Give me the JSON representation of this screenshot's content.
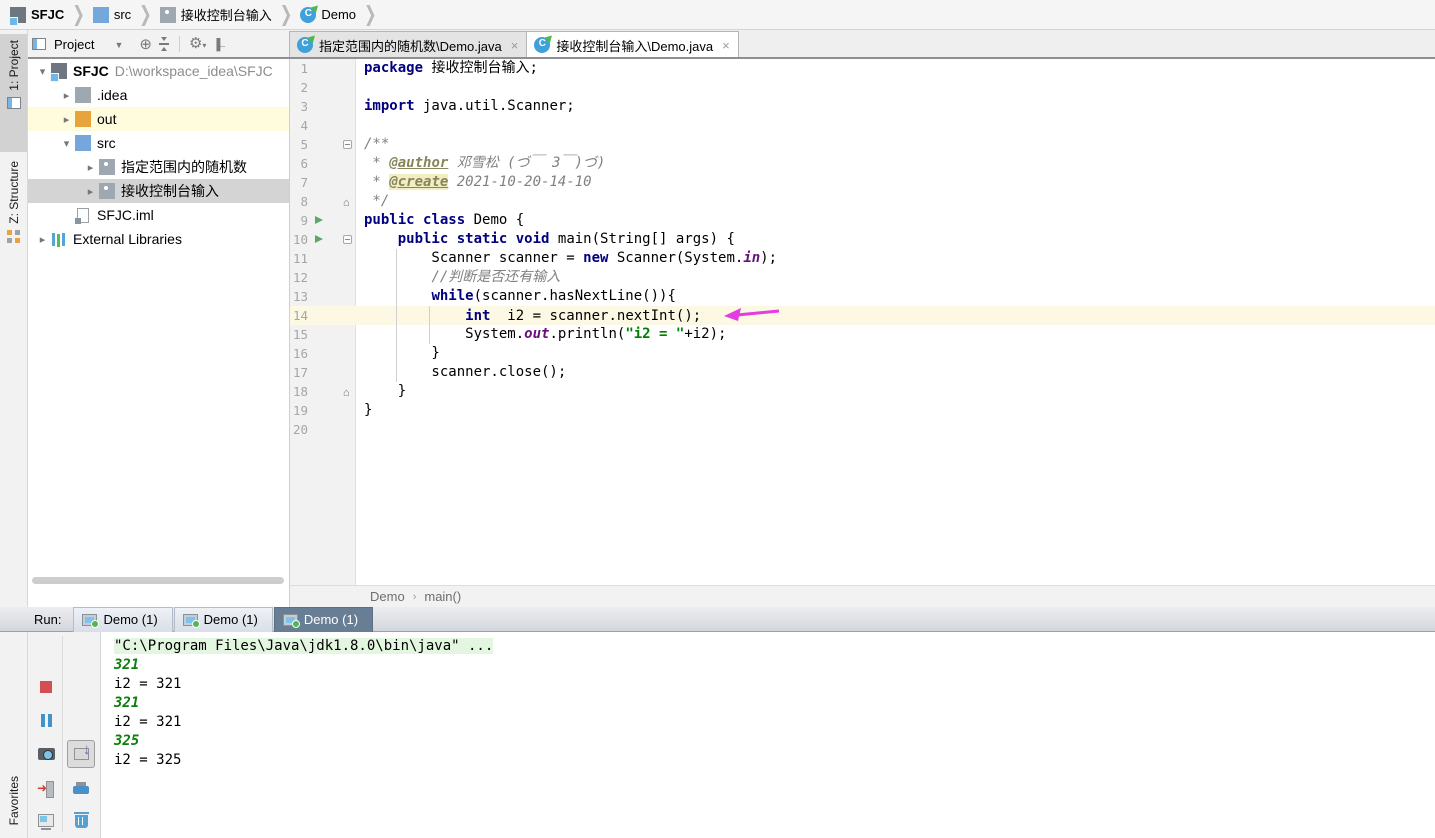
{
  "topbar": {
    "items": [
      {
        "icon": "project-root",
        "label": "SFJC",
        "bold": true
      },
      {
        "icon": "folder-blue",
        "label": "src"
      },
      {
        "icon": "package",
        "label": "接收控制台输入"
      },
      {
        "icon": "class",
        "label": "Demo"
      }
    ]
  },
  "left_tools": {
    "project": "1: Project",
    "structure": "Z: Structure",
    "favorites": "Favorites"
  },
  "project_panel": {
    "title": "Project"
  },
  "editor_tabs": [
    {
      "icon": "class",
      "label": "指定范围内的随机数\\Demo.java",
      "selected": false
    },
    {
      "icon": "class",
      "label": "接收控制台输入\\Demo.java",
      "selected": true
    }
  ],
  "tree": [
    {
      "indent": 0,
      "chevron": "down",
      "icon": "project-root",
      "label": "SFJC",
      "suffix": " D:\\workspace_idea\\SFJC",
      "bold": true
    },
    {
      "indent": 1,
      "chevron": "right",
      "icon": "folder-gray",
      "label": ".idea"
    },
    {
      "indent": 1,
      "chevron": "right",
      "icon": "folder-orange",
      "label": "out",
      "state": "marked"
    },
    {
      "indent": 1,
      "chevron": "down",
      "icon": "folder-blue",
      "label": "src"
    },
    {
      "indent": 2,
      "chevron": "right",
      "icon": "package",
      "label": "指定范围内的随机数"
    },
    {
      "indent": 2,
      "chevron": "right",
      "icon": "package",
      "label": "接收控制台输入",
      "state": "selected"
    },
    {
      "indent": 1,
      "chevron": "none",
      "icon": "file-iml",
      "label": "SFJC.iml"
    },
    {
      "indent": 0,
      "chevron": "right",
      "icon": "library",
      "label": "External Libraries"
    }
  ],
  "code": {
    "lines": [
      {
        "n": 1,
        "segs": [
          [
            "kw",
            "package"
          ],
          [
            "pl",
            " 接收控制台输入;"
          ]
        ]
      },
      {
        "n": 2,
        "segs": []
      },
      {
        "n": 3,
        "segs": [
          [
            "kw",
            "import"
          ],
          [
            "pl",
            " java.util.Scanner;"
          ]
        ]
      },
      {
        "n": 4,
        "segs": []
      },
      {
        "n": 5,
        "fold": "minus",
        "segs": [
          [
            "doc",
            "/**"
          ]
        ]
      },
      {
        "n": 6,
        "segs": [
          [
            "doc",
            " * "
          ],
          [
            "tag",
            "@author"
          ],
          [
            "doc",
            " 邓雪松 (づ￣ 3￣)づ)"
          ]
        ]
      },
      {
        "n": 7,
        "segs": [
          [
            "doc",
            " * "
          ],
          [
            "taghl",
            "@create"
          ],
          [
            "doc",
            " 2021-10-20-14-10"
          ]
        ]
      },
      {
        "n": 8,
        "fold": "end",
        "segs": [
          [
            "doc",
            " */"
          ]
        ]
      },
      {
        "n": 9,
        "run": true,
        "segs": [
          [
            "kw",
            "public"
          ],
          [
            "pl",
            " "
          ],
          [
            "kw",
            "class"
          ],
          [
            "pl",
            " Demo {"
          ]
        ]
      },
      {
        "n": 10,
        "run": true,
        "fold": "minus",
        "segs": [
          [
            "pl",
            "    "
          ],
          [
            "kw",
            "public"
          ],
          [
            "pl",
            " "
          ],
          [
            "kw",
            "static"
          ],
          [
            "pl",
            " "
          ],
          [
            "kw",
            "void"
          ],
          [
            "pl",
            " main(String[] args) {"
          ]
        ]
      },
      {
        "n": 11,
        "segs": [
          [
            "pl",
            "        Scanner scanner = "
          ],
          [
            "kw",
            "new"
          ],
          [
            "pl",
            " Scanner(System."
          ],
          [
            "fld",
            "in"
          ],
          [
            "pl",
            ");"
          ]
        ]
      },
      {
        "n": 12,
        "segs": [
          [
            "pl",
            "        "
          ],
          [
            "cmt",
            "//判断是否还有输入"
          ]
        ]
      },
      {
        "n": 13,
        "segs": [
          [
            "pl",
            "        "
          ],
          [
            "kw",
            "while"
          ],
          [
            "pl",
            "(scanner.hasNextLine()){"
          ]
        ]
      },
      {
        "n": 14,
        "highlight": true,
        "arrow": true,
        "segs": [
          [
            "pl",
            "            "
          ],
          [
            "kw",
            "int"
          ],
          [
            "pl",
            "  i2 = scanner.nextInt();"
          ]
        ]
      },
      {
        "n": 15,
        "segs": [
          [
            "pl",
            "            System."
          ],
          [
            "fld",
            "out"
          ],
          [
            "pl",
            ".println("
          ],
          [
            "str",
            "\"i2 = \""
          ],
          [
            "pl",
            "+i2);"
          ]
        ]
      },
      {
        "n": 16,
        "segs": [
          [
            "pl",
            "        }"
          ]
        ]
      },
      {
        "n": 17,
        "segs": [
          [
            "pl",
            "        scanner.close();"
          ]
        ]
      },
      {
        "n": 18,
        "fold": "end",
        "segs": [
          [
            "pl",
            "    }"
          ]
        ]
      },
      {
        "n": 19,
        "segs": [
          [
            "pl",
            "}"
          ]
        ]
      },
      {
        "n": 20,
        "segs": []
      }
    ]
  },
  "editor_breadcrumb": {
    "items": [
      "Demo",
      "main()"
    ]
  },
  "run_panel": {
    "label": "Run:",
    "tabs": [
      {
        "label": "Demo (1)",
        "selected": false
      },
      {
        "label": "Demo (1)",
        "selected": false
      },
      {
        "label": "Demo (1)",
        "selected": true
      }
    ]
  },
  "console": {
    "lines": [
      {
        "type": "cmd",
        "text": "\"C:\\Program Files\\Java\\jdk1.8.0\\bin\\java\" ..."
      },
      {
        "type": "input",
        "text": "321"
      },
      {
        "type": "stdout",
        "text": "i2 = 321"
      },
      {
        "type": "input",
        "text": "321"
      },
      {
        "type": "stdout",
        "text": "i2 = 321"
      },
      {
        "type": "input",
        "text": "325"
      },
      {
        "type": "stdout",
        "text": "i2 = 325"
      }
    ]
  },
  "console_toolbar": {
    "col1": [
      "rerun",
      "stop",
      "pause",
      "camera",
      "exit",
      "monitor"
    ],
    "col2": [
      "up",
      "down",
      "softwrap",
      "scrollend",
      "print",
      "trash"
    ],
    "selected": "scrollend"
  },
  "colors": {
    "keyword": "#000080",
    "string": "#008000",
    "comment": "#808080",
    "field": "#660E7A",
    "doc_tag": "#85855A",
    "line_highlight": "#FCF8E3",
    "selection_gray": "#D4D4D4",
    "marked_row_yellow": "#FFFCDE",
    "annotation_arrow": "#E23CE2",
    "input_green": "#0B800B",
    "cmd_highlight": "#E3F6DF",
    "run_tab_selected": "#687E95",
    "class_icon_blue": "#3FA0DA",
    "run_arrow_green": "#59A869"
  }
}
